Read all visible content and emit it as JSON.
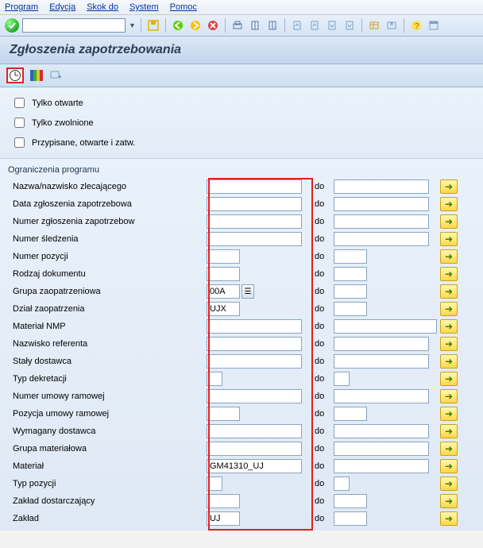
{
  "menu": {
    "program": "Program",
    "edit": "Edycja",
    "jump": "Skok do",
    "system": "System",
    "help": "Pomoc"
  },
  "title": "Zgłoszenia zapotrzebowania",
  "checkboxes": {
    "open": "Tylko otwarte",
    "released": "Tylko zwolnione",
    "assigned": "Przypisane, otwarte i zatw."
  },
  "section": "Ograniczenia programu",
  "to": "do",
  "rows": [
    {
      "label": "Nazwa/nazwisko zlecającego",
      "v1": "",
      "v2": "",
      "w": "full",
      "w2": "full"
    },
    {
      "label": "Data zgłoszenia zapotrzebowa",
      "v1": "",
      "v2": "",
      "w": "full",
      "w2": "full"
    },
    {
      "label": "Numer zgłoszenia zapotrzebow",
      "v1": "",
      "v2": "",
      "w": "full",
      "w2": "full"
    },
    {
      "label": "Numer śledzenia",
      "v1": "",
      "v2": "",
      "w": "full",
      "w2": "full"
    },
    {
      "label": "Numer pozycji",
      "v1": "",
      "v2": "",
      "w": "short",
      "w2": "short"
    },
    {
      "label": "Rodzaj dokumentu",
      "v1": "",
      "v2": "",
      "w": "short",
      "w2": "short"
    },
    {
      "label": "Grupa zaopatrzeniowa",
      "v1": "00A",
      "v2": "",
      "w": "short",
      "w2": "short",
      "helper": true
    },
    {
      "label": "Dział zaopatrzenia",
      "v1": "UJX",
      "v2": "",
      "w": "short",
      "w2": "short"
    },
    {
      "label": "Materiał NMP",
      "v1": "",
      "v2": "",
      "w": "full",
      "w2": "full",
      "wide2": true
    },
    {
      "label": "Nazwisko referenta",
      "v1": "",
      "v2": "",
      "w": "full",
      "w2": "full"
    },
    {
      "label": "Stały dostawca",
      "v1": "",
      "v2": "",
      "w": "full",
      "w2": "full"
    },
    {
      "label": "Typ dekretacji",
      "v1": "",
      "v2": "",
      "w": "tiny",
      "w2": "tiny"
    },
    {
      "label": "Numer umowy ramowej",
      "v1": "",
      "v2": "",
      "w": "full",
      "w2": "full"
    },
    {
      "label": "Pozycja umowy ramowej",
      "v1": "",
      "v2": "",
      "w": "short",
      "w2": "short"
    },
    {
      "label": "Wymagany dostawca",
      "v1": "",
      "v2": "",
      "w": "full",
      "w2": "full"
    },
    {
      "label": "Grupa materiałowa",
      "v1": "",
      "v2": "",
      "w": "full",
      "w2": "full"
    },
    {
      "label": "Materiał",
      "v1": "GM41310_UJ",
      "v2": "",
      "w": "full",
      "w2": "full"
    },
    {
      "label": "Typ pozycji",
      "v1": "",
      "v2": "",
      "w": "tiny",
      "w2": "tiny"
    },
    {
      "label": "Zakład dostarczający",
      "v1": "",
      "v2": "",
      "w": "short",
      "w2": "short"
    },
    {
      "label": "Zakład",
      "v1": "UJ",
      "v2": "",
      "w": "short",
      "w2": "short"
    }
  ]
}
